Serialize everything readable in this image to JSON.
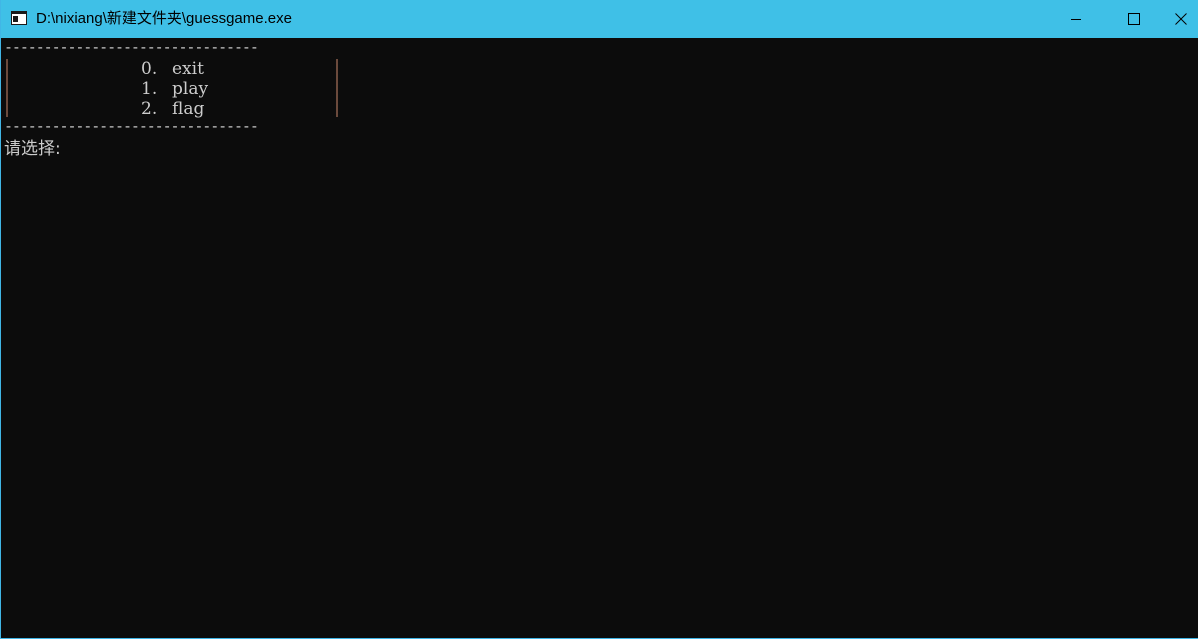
{
  "window": {
    "title": "D:\\nixiang\\新建文件夹\\guessgame.exe",
    "titlebar_color": "#3fc0e7",
    "background_color": "#0c0c0c",
    "text_color": "#cccccc"
  },
  "controls": {
    "minimize_icon": "minimize-icon",
    "maximize_icon": "maximize-icon",
    "close_icon": "close-icon"
  },
  "console": {
    "separator_top": "--------------------------------",
    "menu_items": [
      {
        "number": "0.",
        "label": "exit"
      },
      {
        "number": "1.",
        "label": "play"
      },
      {
        "number": "2.",
        "label": "flag"
      }
    ],
    "separator_bottom": "--------------------------------",
    "prompt": "请选择:"
  }
}
